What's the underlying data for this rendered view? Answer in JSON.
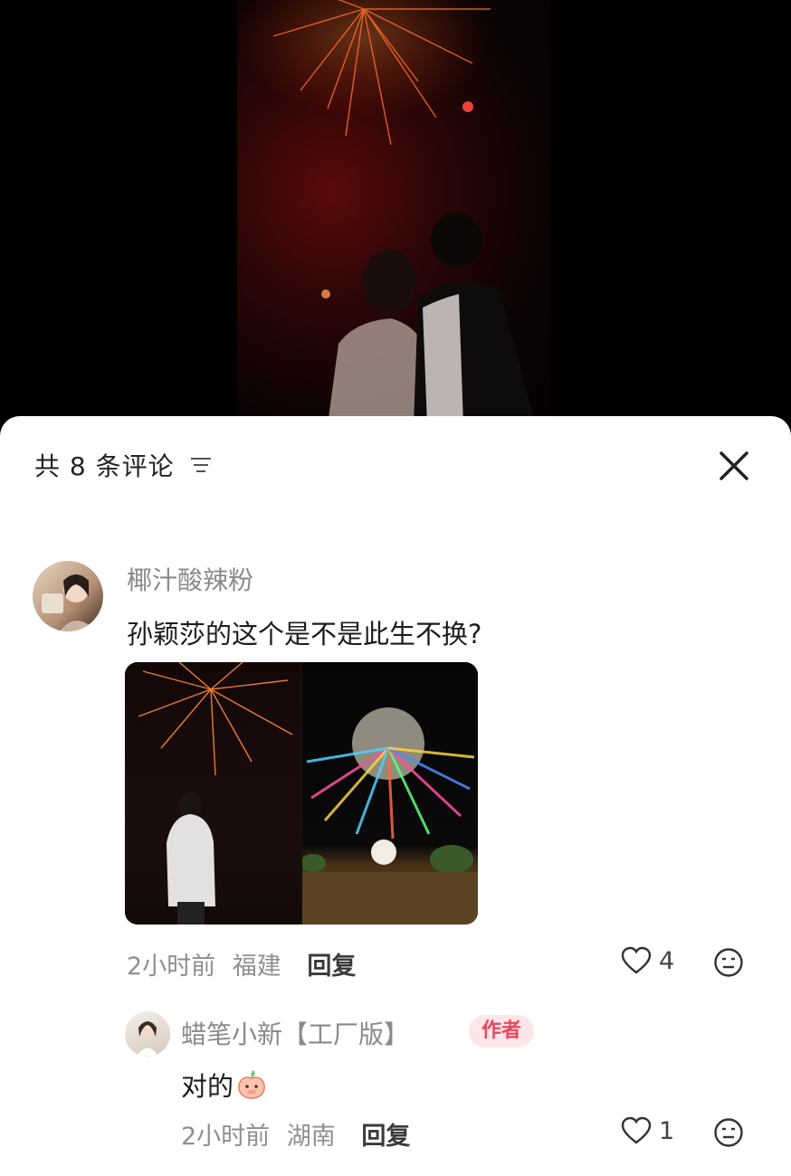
{
  "header": {
    "title": "共 8 条评论"
  },
  "comments": [
    {
      "username": "椰汁酸辣粉",
      "text": "孙颖莎的这个是不是此生不换?",
      "time": "2小时前",
      "location": "福建",
      "reply_label": "回复",
      "likes": "4"
    }
  ],
  "replies": [
    {
      "username": "蜡笔小新【工厂版】",
      "badge": "作者",
      "text": "对的",
      "time": "2小时前",
      "location": "湖南",
      "reply_label": "回复",
      "likes": "1"
    }
  ],
  "colors": {
    "accent_badge_bg": "#fde6ea",
    "accent_badge_text": "#e8485e",
    "sheet_bg": "#ffffff"
  },
  "icons": [
    "sort-icon",
    "close-icon",
    "heart-icon",
    "emoji-icon",
    "peach-emoji-icon"
  ]
}
